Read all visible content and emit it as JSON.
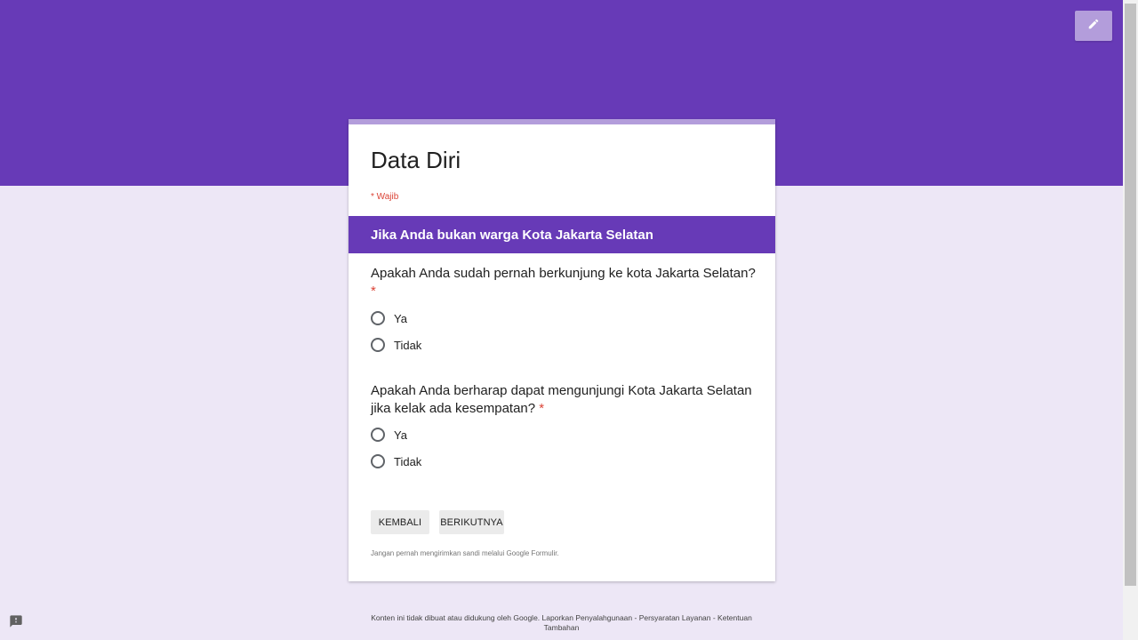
{
  "form": {
    "title": "Data Diri",
    "required_note": "* Wajib",
    "section_title": "Jika Anda bukan warga Kota Jakarta Selatan",
    "questions": [
      {
        "text": "Apakah Anda sudah pernah berkunjung ke kota Jakarta Selatan?",
        "required_marker": "*",
        "options": [
          "Ya",
          "Tidak"
        ]
      },
      {
        "text": "Apakah Anda berharap dapat mengunjungi Kota Jakarta Selatan jika kelak ada kesempatan?",
        "required_marker": "*",
        "options": [
          "Ya",
          "Tidak"
        ]
      }
    ],
    "back_label": "KEMBALI",
    "next_label": "BERIKUTNYA",
    "password_warning": "Jangan pernah mengirimkan sandi melalui Google Formulir."
  },
  "footer": {
    "text": "Konten ini tidak dibuat atau didukung oleh Google. Laporkan Penyalahgunaan - Persyaratan Layanan - Ketentuan Tambahan"
  },
  "icons": {
    "edit": "pencil-icon",
    "report": "report-problem-icon"
  },
  "colors": {
    "theme": "#673ab7",
    "background": "#ede7f6",
    "accent_light": "#b39ddb",
    "required": "#db4437"
  }
}
